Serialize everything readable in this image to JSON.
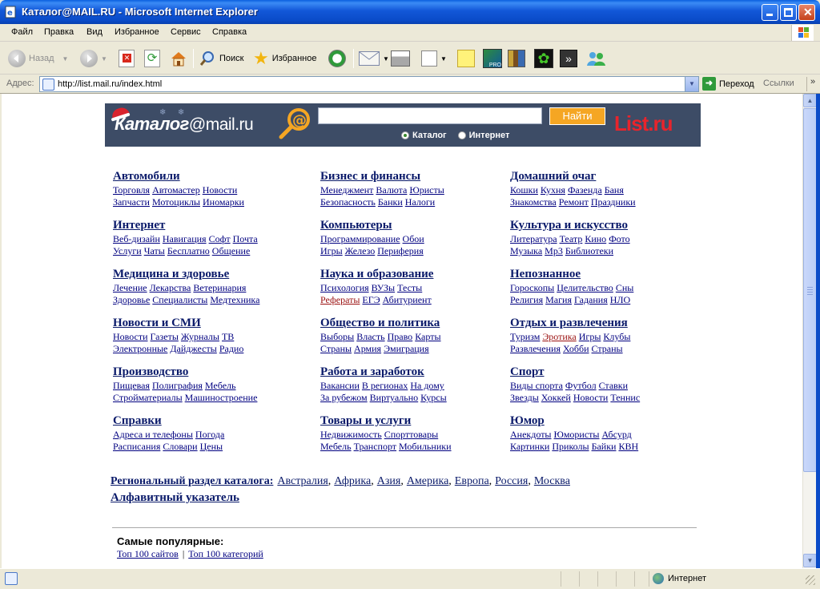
{
  "window": {
    "title": "Каталог@MAIL.RU - Microsoft Internet Explorer"
  },
  "menu": [
    "Файл",
    "Правка",
    "Вид",
    "Избранное",
    "Сервис",
    "Справка"
  ],
  "toolbar": {
    "back": "Назад",
    "search": "Поиск",
    "favorites": "Избранное"
  },
  "address": {
    "label": "Адрес:",
    "url": "http://list.mail.ru/index.html",
    "go": "Переход",
    "links": "Ссылки"
  },
  "banner": {
    "logo_katalog": "Каталог",
    "logo_mail": "@mail.ru",
    "search_value": "",
    "find_button": "Найти",
    "radio_catalog": "Каталог",
    "radio_internet": "Интернет",
    "listru": "List.ru"
  },
  "categories": [
    {
      "title": "Автомобили",
      "lines": [
        [
          "Торговля",
          "Автомастер",
          "Новости"
        ],
        [
          "Запчасти",
          "Мотоциклы",
          "Иномарки"
        ]
      ]
    },
    {
      "title": "Бизнес и финансы",
      "lines": [
        [
          "Менеджмент",
          "Валюта",
          "Юристы"
        ],
        [
          "Безопасность",
          "Банки",
          "Налоги"
        ]
      ]
    },
    {
      "title": "Домашний очаг",
      "lines": [
        [
          "Кошки",
          "Кухня",
          "Фазенда",
          "Баня"
        ],
        [
          "Знакомства",
          "Ремонт",
          "Праздники"
        ]
      ]
    },
    {
      "title": "Интернет",
      "lines": [
        [
          "Веб-дизайн",
          "Навигация",
          "Софт",
          "Почта"
        ],
        [
          "Услуги",
          "Чаты",
          "Бесплатно",
          "Общение"
        ]
      ]
    },
    {
      "title": "Компьютеры",
      "lines": [
        [
          "Программирование",
          "Обои"
        ],
        [
          "Игры",
          "Железо",
          "Периферия"
        ]
      ]
    },
    {
      "title": "Культура и искусство",
      "lines": [
        [
          "Литература",
          "Театр",
          "Кино",
          "Фото"
        ],
        [
          "Музыка",
          "Mp3",
          "Библиотеки"
        ]
      ]
    },
    {
      "title": "Медицина и здоровье",
      "lines": [
        [
          "Лечение",
          "Лекарства",
          "Ветеринария"
        ],
        [
          "Здоровье",
          "Специалисты",
          "Медтехника"
        ]
      ]
    },
    {
      "title": "Наука и образование",
      "lines": [
        [
          "Психология",
          "ВУЗы",
          "Тесты"
        ],
        [
          "Рефераты",
          "ЕГЭ",
          "Абитуриент"
        ]
      ]
    },
    {
      "title": "Непознанное",
      "lines": [
        [
          "Гороскопы",
          "Целительство",
          "Сны"
        ],
        [
          "Религия",
          "Магия",
          "Гадания",
          "НЛО"
        ]
      ]
    },
    {
      "title": "Новости и СМИ",
      "lines": [
        [
          "Новости",
          "Газеты",
          "Журналы",
          "ТВ"
        ],
        [
          "Электронные",
          "Дайджесты",
          "Радио"
        ]
      ]
    },
    {
      "title": "Общество и политика",
      "lines": [
        [
          "Выборы",
          "Власть",
          "Право",
          "Карты"
        ],
        [
          "Страны",
          "Армия",
          "Эмиграция"
        ]
      ]
    },
    {
      "title": "Отдых и развлечения",
      "lines": [
        [
          "Туризм",
          "Эротика",
          "Игры",
          "Клубы"
        ],
        [
          "Развлечения",
          "Хобби",
          "Страны"
        ]
      ]
    },
    {
      "title": "Производство",
      "lines": [
        [
          "Пищевая",
          "Полиграфия",
          "Мебель"
        ],
        [
          "Стройматериалы",
          "Машиностроение"
        ]
      ]
    },
    {
      "title": "Работа и заработок",
      "lines": [
        [
          "Вакансии",
          "В регионах",
          "На дому"
        ],
        [
          "За рубежом",
          "Виртуально",
          "Курсы"
        ]
      ]
    },
    {
      "title": "Спорт",
      "lines": [
        [
          "Виды спорта",
          "Футбол",
          "Ставки"
        ],
        [
          "Звезды",
          "Хоккей",
          "Новости",
          "Теннис"
        ]
      ]
    },
    {
      "title": "Справки",
      "lines": [
        [
          "Адреса и телефоны",
          "Погода"
        ],
        [
          "Расписания",
          "Словари",
          "Цены"
        ]
      ]
    },
    {
      "title": "Товары и услуги",
      "lines": [
        [
          "Недвижимость",
          "Спорттовары"
        ],
        [
          "Мебель",
          "Транспорт",
          "Мобильники"
        ]
      ]
    },
    {
      "title": "Юмор",
      "lines": [
        [
          "Анекдоты",
          "Юмористы",
          "Абсурд"
        ],
        [
          "Картинки",
          "Приколы",
          "Байки",
          "КВН"
        ]
      ]
    }
  ],
  "regional": {
    "label": "Региональный раздел каталога:",
    "items": [
      "Австралия",
      "Африка",
      "Азия",
      "Америка",
      "Европа",
      "Россия",
      "Москва"
    ]
  },
  "alphabet": "Алфавитный указатель",
  "popular": {
    "title": "Самые популярные:",
    "links": [
      "Топ 100 сайтов",
      "Топ 100 категорий"
    ]
  },
  "status": {
    "zone": "Интернет"
  },
  "colors": {
    "banner_bg": "#3d4c66",
    "find_button": "#f5a623",
    "listru": "#e8242c",
    "link": "#000080",
    "visited_link": "#9a1010"
  }
}
